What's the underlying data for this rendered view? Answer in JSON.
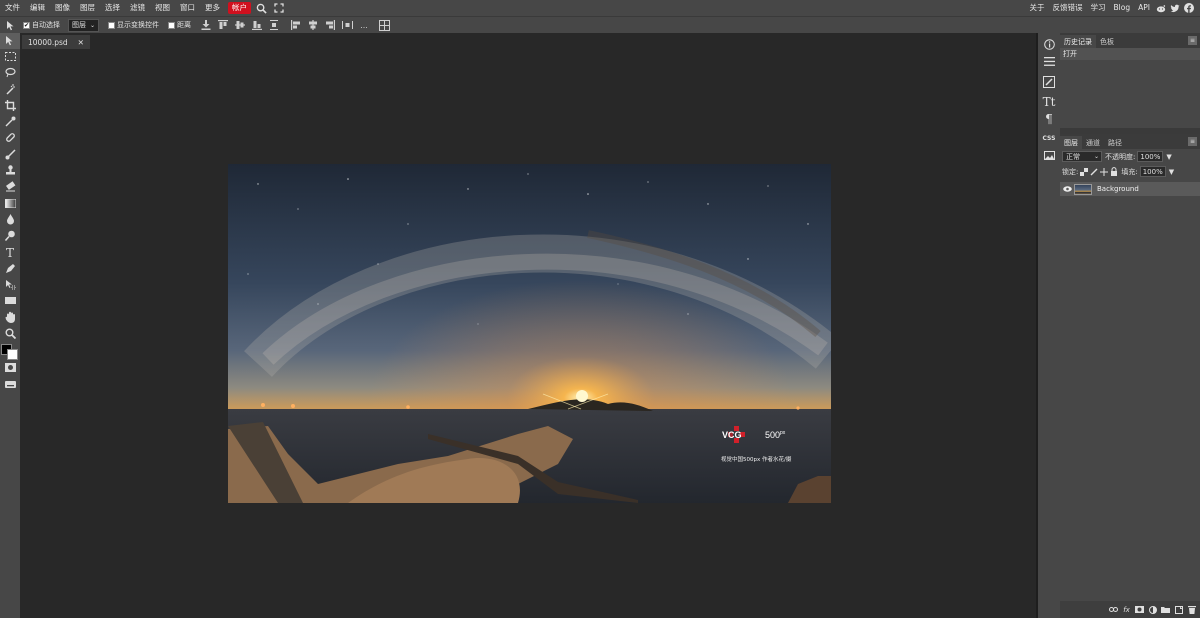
{
  "menubar": {
    "items": [
      "文件",
      "编辑",
      "图像",
      "图层",
      "选择",
      "滤镜",
      "视图",
      "窗口",
      "更多"
    ],
    "account": "帐户",
    "right_items": [
      "关于",
      "反馈错误",
      "学习",
      "Blog",
      "API"
    ],
    "colors": {
      "accent": "#d0101e"
    }
  },
  "options": {
    "auto_select": "自动选择",
    "layer_select": "图层",
    "show_transform": "显示变换控件",
    "distance": "距离",
    "more": "..."
  },
  "document": {
    "tab_name": "10000.psd",
    "close": "✕"
  },
  "image": {
    "brand": "VCG",
    "brand_right": "500",
    "brand_sup": "px",
    "credit": "视觉中国500px 作者水花/摄"
  },
  "history_panel": {
    "tabs": [
      "历史记录",
      "色板"
    ],
    "items": [
      "打开"
    ]
  },
  "layers_panel": {
    "tabs": [
      "图层",
      "通道",
      "路径"
    ],
    "blend_mode": "正常",
    "opacity_label": "不透明度:",
    "opacity_value": "100%",
    "lock_label": "锁定:",
    "fill_label": "填充:",
    "fill_value": "100%",
    "layers": [
      {
        "name": "Background"
      }
    ]
  }
}
